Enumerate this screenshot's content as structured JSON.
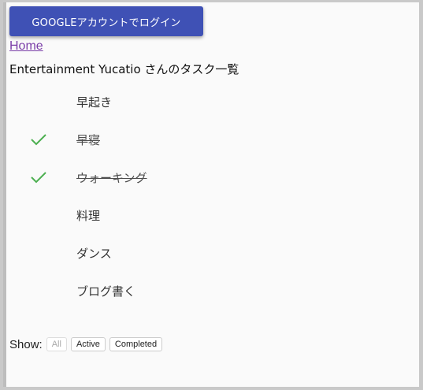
{
  "header": {
    "login_button_label": "GOOGLEアカウントでログイン",
    "accent_color": "#3f51b5"
  },
  "nav": {
    "home_link_label": "Home"
  },
  "page": {
    "title": "Entertainment Yucatio さんのタスク一覧"
  },
  "tasks": [
    {
      "label": "早起き",
      "completed": false
    },
    {
      "label": "早寝",
      "completed": true
    },
    {
      "label": "ウォーキング",
      "completed": true
    },
    {
      "label": "料理",
      "completed": false
    },
    {
      "label": "ダンス",
      "completed": false
    },
    {
      "label": "ブログ書く",
      "completed": false
    }
  ],
  "check_icon": "check-icon",
  "check_color": "#4caf50",
  "filter": {
    "label": "Show:",
    "options": [
      {
        "label": "All",
        "active": true
      },
      {
        "label": "Active",
        "active": false
      },
      {
        "label": "Completed",
        "active": false
      }
    ]
  }
}
